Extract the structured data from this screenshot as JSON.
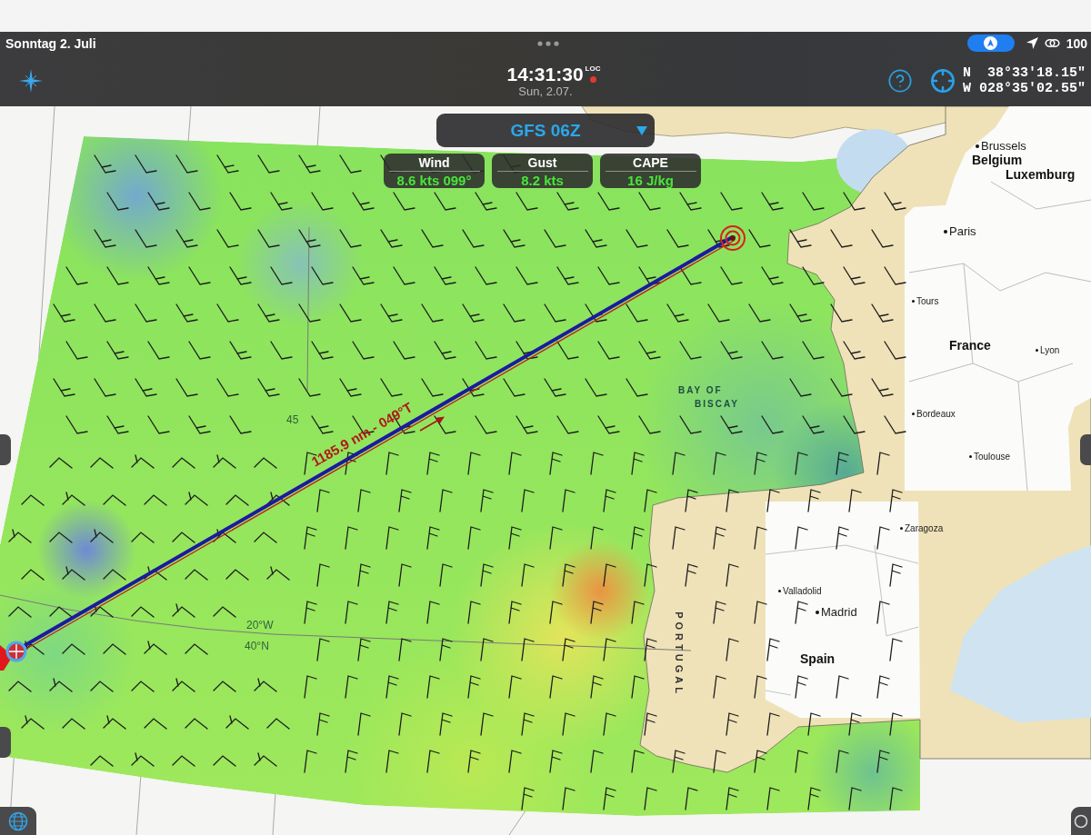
{
  "status_bar": {
    "date": "Sonntag 2. Juli",
    "battery": "100"
  },
  "toolbar": {
    "time": "14:31:30",
    "time_reference": "LOC",
    "date": "Sun, 2.07.",
    "latitude": "N  38°33'18.15\"",
    "longitude": "W 028°35'02.55\""
  },
  "model_selector": {
    "value": "GFS 06Z"
  },
  "readouts": [
    {
      "label": "Wind",
      "value": "8.6 kts 099°"
    },
    {
      "label": "Gust",
      "value": "8.2 kts"
    },
    {
      "label": "CAPE",
      "value": "16 J/kg"
    }
  ],
  "route": {
    "label": "1185.9 nm - 049°T"
  },
  "map_labels": [
    {
      "text": "Brussels",
      "kind": "city"
    },
    {
      "text": "Belgium",
      "kind": "country"
    },
    {
      "text": "Luxemburg",
      "kind": "country"
    },
    {
      "text": "Paris",
      "kind": "city"
    },
    {
      "text": "Tours",
      "kind": "town"
    },
    {
      "text": "France",
      "kind": "country"
    },
    {
      "text": "Lyon",
      "kind": "town"
    },
    {
      "text": "Bordeaux",
      "kind": "town"
    },
    {
      "text": "Toulouse",
      "kind": "town"
    },
    {
      "text": "Zaragoza",
      "kind": "town"
    },
    {
      "text": "Valladolid",
      "kind": "town"
    },
    {
      "text": "Madrid",
      "kind": "city"
    },
    {
      "text": "Spain",
      "kind": "country"
    },
    {
      "text": "BAY OF",
      "kind": "sea"
    },
    {
      "text": "BISCAY",
      "kind": "sea"
    },
    {
      "text": "PORTUGAL",
      "kind": "border"
    },
    {
      "text": "45",
      "kind": "grid"
    },
    {
      "text": "20°W",
      "kind": "grid"
    },
    {
      "text": "40°N",
      "kind": "grid"
    }
  ]
}
